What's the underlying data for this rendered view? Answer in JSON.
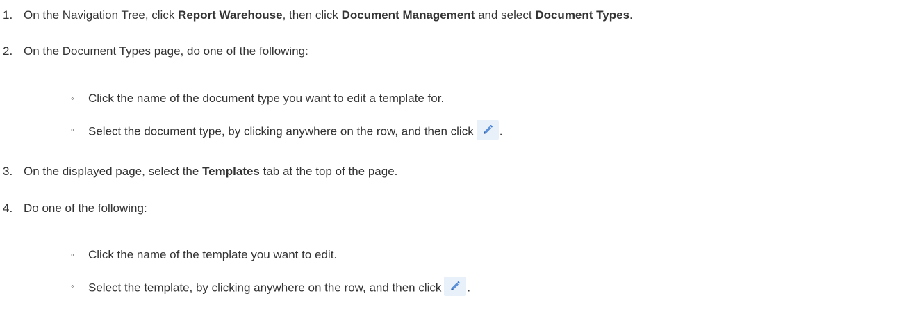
{
  "steps": [
    {
      "number": "1.",
      "parts": [
        {
          "t": "On the Navigation Tree, click "
        },
        {
          "b": "Report Warehouse"
        },
        {
          "t": ", then click "
        },
        {
          "b": "Document Management"
        },
        {
          "t": " and select "
        },
        {
          "b": "Document Types"
        },
        {
          "t": "."
        }
      ]
    },
    {
      "number": "2.",
      "text": "On the Document Types page, do one of the following:",
      "subs": [
        {
          "text": "Click the name of the document type you want to edit a template for."
        },
        {
          "text": "Select the document type, by clicking anywhere on the row, and then click",
          "icon": "pencil-edit-icon",
          "after": "."
        }
      ]
    },
    {
      "number": "3.",
      "parts": [
        {
          "t": "On the displayed page, select the "
        },
        {
          "b": "Templates"
        },
        {
          "t": " tab at the top of the page."
        }
      ]
    },
    {
      "number": "4.",
      "text": "Do one of the following:",
      "subs": [
        {
          "text": "Click the name of the template you want to edit."
        },
        {
          "text": "Select the template, by clicking anywhere on the row, and then click",
          "icon": "pencil-edit-icon",
          "after": "."
        }
      ]
    }
  ],
  "bullet_char": "◦",
  "colors": {
    "text": "#333333",
    "icon_bg": "#e8f0fa",
    "icon_pencil": "#3a7bd5"
  }
}
